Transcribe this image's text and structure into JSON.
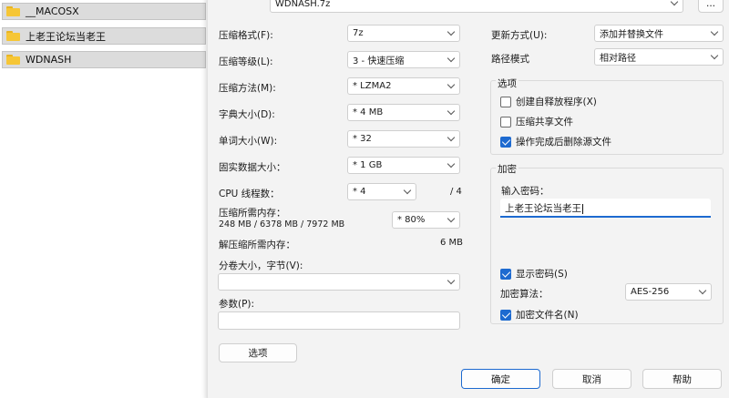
{
  "files": [
    {
      "name": "__MACOSX"
    },
    {
      "name": "上老王论坛当老王"
    },
    {
      "name": "WDNASH"
    }
  ],
  "archive": {
    "filename": "WDNASH.7z",
    "browse_label": "..."
  },
  "left": {
    "format": {
      "label": "压缩格式(F):",
      "value": "7z"
    },
    "level": {
      "label": "压缩等级(L):",
      "value": "3 - 快速压缩"
    },
    "method": {
      "label": "压缩方法(M):",
      "value": "* LZMA2"
    },
    "dict": {
      "label": "字典大小(D):",
      "value": "* 4 MB"
    },
    "word": {
      "label": "单词大小(W):",
      "value": "* 32"
    },
    "solid": {
      "label": "固实数据大小：",
      "value": "* 1 GB"
    },
    "threads": {
      "label": "CPU 线程数：",
      "value": "* 4",
      "max": "/ 4"
    },
    "mem_comp": {
      "label": "压缩所需内存：",
      "detail": "248 MB / 6378 MB / 7972 MB",
      "value": "* 80%"
    },
    "mem_decomp": {
      "label": "解压缩所需内存：",
      "value": "6 MB"
    },
    "split": {
      "label": "分卷大小，字节(V):",
      "value": ""
    },
    "params": {
      "label": "参数(P):",
      "value": ""
    },
    "options_button": "选项"
  },
  "right": {
    "update": {
      "label": "更新方式(U):",
      "value": "添加并替换文件"
    },
    "path": {
      "label": "路径模式",
      "value": "相对路径"
    },
    "options_title": "选项",
    "sfx": {
      "label": "创建自释放程序(X)",
      "checked": false
    },
    "shared": {
      "label": "压缩共享文件",
      "checked": false
    },
    "delete": {
      "label": "操作完成后删除源文件",
      "checked": true
    },
    "encrypt_title": "加密",
    "password_label": "输入密码：",
    "password_value": "上老王论坛当老王",
    "show_pwd": {
      "label": "显示密码(S)",
      "checked": true
    },
    "enc_method": {
      "label": "加密算法：",
      "value": "AES-256"
    },
    "enc_names": {
      "label": "加密文件名(N)",
      "checked": true
    }
  },
  "buttons": {
    "ok": "确定",
    "cancel": "取消",
    "help": "帮助"
  },
  "colors": {
    "accent": "#1d6ad0",
    "dialog_bg": "#f3f3f3",
    "folder": "#f6c636"
  }
}
